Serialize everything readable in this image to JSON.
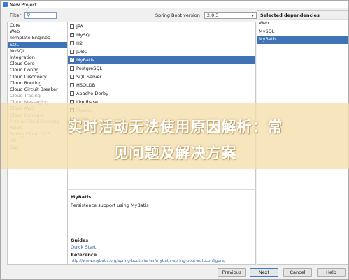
{
  "window": {
    "title": "New Project"
  },
  "filter": {
    "label": "Filter",
    "value": ""
  },
  "boot_version": {
    "label": "Spring Boot version",
    "value": "2.0.3"
  },
  "categories": [
    {
      "label": "Core",
      "selected": false,
      "dim": false
    },
    {
      "label": "Web",
      "selected": false,
      "dim": false
    },
    {
      "label": "Template Engines",
      "selected": false,
      "dim": false
    },
    {
      "label": "SQL",
      "selected": true,
      "dim": false
    },
    {
      "label": "NoSQL",
      "selected": false,
      "dim": false
    },
    {
      "label": "Integration",
      "selected": false,
      "dim": false
    },
    {
      "label": "Cloud Core",
      "selected": false,
      "dim": false
    },
    {
      "label": "Cloud Config",
      "selected": false,
      "dim": false
    },
    {
      "label": "Cloud Discovery",
      "selected": false,
      "dim": false
    },
    {
      "label": "Cloud Routing",
      "selected": false,
      "dim": false
    },
    {
      "label": "Cloud Circuit Breaker",
      "selected": false,
      "dim": false
    },
    {
      "label": "Cloud Tracing",
      "selected": false,
      "dim": true
    },
    {
      "label": "Cloud Messaging",
      "selected": false,
      "dim": true
    },
    {
      "label": "Cloud AWS",
      "selected": false,
      "dim": true
    },
    {
      "label": "Cloud Contract",
      "selected": false,
      "dim": true
    },
    {
      "label": "Pivotal Cloud Foundry",
      "selected": false,
      "dim": true
    },
    {
      "label": "Azure",
      "selected": false,
      "dim": true
    },
    {
      "label": "Spring Cloud GCP",
      "selected": false,
      "dim": true
    },
    {
      "label": "I/O",
      "selected": false,
      "dim": true
    },
    {
      "label": "Ops",
      "selected": false,
      "dim": true
    }
  ],
  "dependencies": [
    {
      "label": "JPA",
      "checked": false,
      "selected": false,
      "dim": false
    },
    {
      "label": "MySQL",
      "checked": true,
      "selected": false,
      "dim": false
    },
    {
      "label": "H2",
      "checked": false,
      "selected": false,
      "dim": false
    },
    {
      "label": "JDBC",
      "checked": false,
      "selected": false,
      "dim": false
    },
    {
      "label": "MyBatis",
      "checked": true,
      "selected": true,
      "dim": false
    },
    {
      "label": "PostgreSQL",
      "checked": false,
      "selected": false,
      "dim": false
    },
    {
      "label": "SQL Server",
      "checked": false,
      "selected": false,
      "dim": false
    },
    {
      "label": "HSQLDB",
      "checked": false,
      "selected": false,
      "dim": false
    },
    {
      "label": "Apache Derby",
      "checked": false,
      "selected": false,
      "dim": false
    },
    {
      "label": "Liquibase",
      "checked": false,
      "selected": false,
      "dim": false
    },
    {
      "label": "Flyway",
      "checked": false,
      "selected": false,
      "dim": true
    },
    {
      "label": "jOOQ",
      "checked": false,
      "selected": false,
      "dim": true
    }
  ],
  "detail": {
    "name": "MyBatis",
    "description": "Persistence support using MyBatis",
    "guides_label": "Guides",
    "quick_start": "Quick Start",
    "reference_label": "Reference",
    "reference_url": "http://www.mybatis.org/spring-boot-starter/mybatis-spring-boot-autoconfigure/"
  },
  "selected_dependencies": {
    "header": "Selected dependencies",
    "items": [
      {
        "label": "Web",
        "selected": false
      },
      {
        "label": "MySQL",
        "selected": false
      },
      {
        "label": "MyBatis",
        "selected": true
      }
    ]
  },
  "buttons": {
    "previous": "Previous",
    "next": "Next",
    "cancel": "Cancel",
    "help": "Help"
  },
  "overlay": {
    "line1": "实时活动无法使用原因解析：常",
    "line2": "见问题及解决方案"
  },
  "colors": {
    "selection": "#3f73b5",
    "link": "#2a5db0"
  }
}
